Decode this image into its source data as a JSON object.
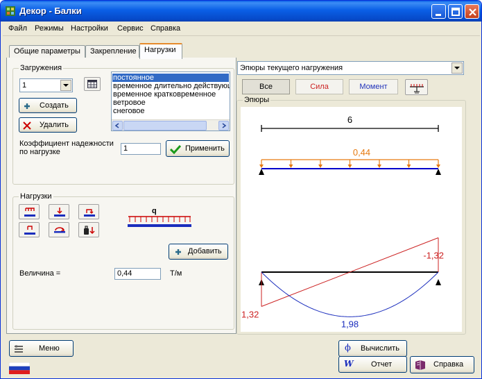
{
  "window": {
    "title": "Декор - Балки",
    "colors": {
      "titlebar": "#0a5fe6",
      "dialog_bg": "#ece9d8",
      "accent_tab": "#e68b2c"
    }
  },
  "menu": [
    "Файл",
    "Режимы",
    "Настройки",
    "Сервис",
    "Справка"
  ],
  "tabs": [
    {
      "label": "Общие параметры",
      "active": false
    },
    {
      "label": "Закрепление",
      "active": false
    },
    {
      "label": "Нагрузки",
      "active": true
    }
  ],
  "zagruzheniya": {
    "group_label": "Загружения",
    "selected_number": "1",
    "create_label": "Создать",
    "delete_label": "Удалить",
    "list_items": [
      "постоянное",
      "временное длительно действующее",
      "временное кратковременное",
      "ветровое",
      "снеговое"
    ],
    "selected_index": 0,
    "reliability_label_line1": "Коэффициент надежности",
    "reliability_label_line2": "по нагрузке",
    "reliability_value": "1",
    "apply_label": "Применить"
  },
  "nagruzki": {
    "group_label": "Нагрузки",
    "preview_label": "q",
    "add_label": "Добавить",
    "value_label": "Величина =",
    "value": "0,44",
    "unit": "Т/м"
  },
  "diagram_panel": {
    "mode_combo_value": "Эпюры текущего нагружения",
    "toggles": [
      {
        "label": "Все",
        "color": "#000000",
        "pressed": true
      },
      {
        "label": "Сила",
        "color": "#cc2222",
        "pressed": false
      },
      {
        "label": "Момент",
        "color": "#2233bb",
        "pressed": false
      }
    ],
    "group_label": "Эпюры"
  },
  "chart_data": [
    {
      "type": "line",
      "title": "",
      "beam_length": 6,
      "beam_length_label": "6",
      "distributed_load": 0.44,
      "load_label": "0,44",
      "shear_force": {
        "x": [
          0,
          6
        ],
        "y": [
          1.32,
          -1.32
        ],
        "labels": [
          "1,32",
          "-1,32"
        ],
        "color": "#cc2222"
      },
      "bending_moment": {
        "x": [
          0,
          1,
          2,
          3,
          4,
          5,
          6
        ],
        "y": [
          0,
          1.1,
          1.76,
          1.98,
          1.76,
          1.1,
          0
        ],
        "max_label": "1,98",
        "color": "#1a2dbd"
      },
      "load_color": "#e67a10",
      "beam_color": "#0000cc"
    }
  ],
  "bottom": {
    "menu_label": "Меню",
    "calc_label": "Вычислить",
    "report_label": "Отчет",
    "help_label": "Справка"
  }
}
